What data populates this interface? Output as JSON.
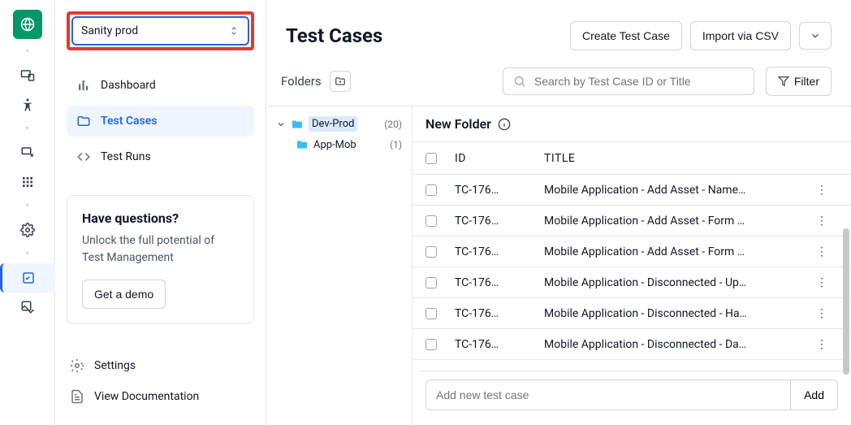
{
  "project_selector": {
    "value": "Sanity prod"
  },
  "sidebar": {
    "items": [
      {
        "label": "Dashboard"
      },
      {
        "label": "Test Cases"
      },
      {
        "label": "Test Runs"
      }
    ],
    "card": {
      "title": "Have questions?",
      "body": "Unlock the full potential of Test Management",
      "cta": "Get a demo"
    },
    "bottom": [
      {
        "label": "Settings"
      },
      {
        "label": "View Documentation"
      }
    ]
  },
  "page": {
    "title": "Test Cases",
    "actions": {
      "create": "Create Test Case",
      "import": "Import via CSV"
    }
  },
  "toolbar": {
    "folders_label": "Folders",
    "search_placeholder": "Search by Test Case ID or Title",
    "filter_label": "Filter"
  },
  "tree": {
    "items": [
      {
        "label": "Dev-Prod",
        "count": "(20)"
      },
      {
        "label": "App-Mob",
        "count": "(1)"
      }
    ]
  },
  "panel": {
    "title": "New Folder",
    "columns": {
      "id": "ID",
      "title": "TITLE"
    },
    "rows": [
      {
        "id": "TC-176…",
        "title": "Mobile Application - Add Asset - Name…"
      },
      {
        "id": "TC-176…",
        "title": "Mobile Application - Add Asset - Form …"
      },
      {
        "id": "TC-176…",
        "title": "Mobile Application - Add Asset - Form …"
      },
      {
        "id": "TC-176…",
        "title": "Mobile Application - Disconnected - Up…"
      },
      {
        "id": "TC-176…",
        "title": "Mobile Application - Disconnected - Ha…"
      },
      {
        "id": "TC-176…",
        "title": "Mobile Application - Disconnected - Da…"
      }
    ],
    "add_placeholder": "Add new test case",
    "add_label": "Add"
  }
}
